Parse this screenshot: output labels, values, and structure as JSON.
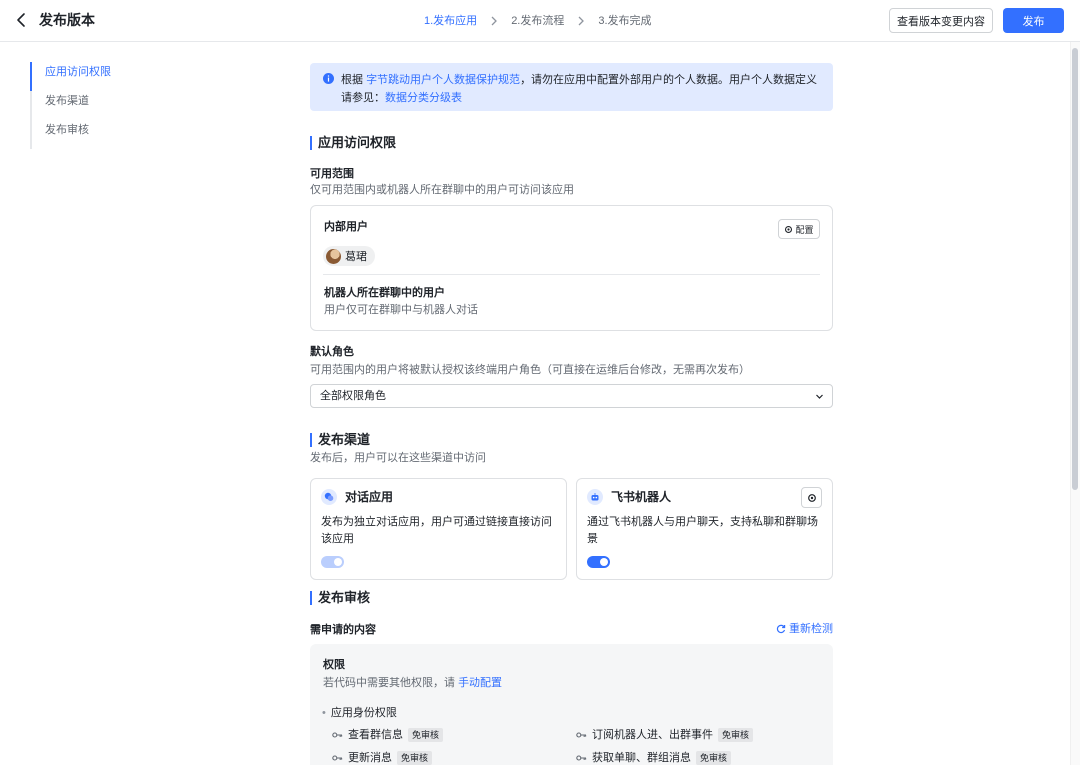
{
  "header": {
    "title": "发布版本",
    "steps": [
      "1.发布应用",
      "2.发布流程",
      "3.发布完成"
    ],
    "view_changes_label": "查看版本变更内容",
    "publish_label": "发布"
  },
  "sidebar": {
    "items": [
      "应用访问权限",
      "发布渠道",
      "发布审核"
    ],
    "active_index": 0
  },
  "notice": {
    "prefix": "根据",
    "link1": "字节跳动用户个人数据保护规范",
    "middle": "，请勿在应用中配置外部用户的个人数据。用户个人数据定义请参见：",
    "link2": "数据分类分级表"
  },
  "access": {
    "section_title": "应用访问权限",
    "scope_label": "可用范围",
    "scope_desc": "仅可用范围内或机器人所在群聊中的用户可访问该应用",
    "internal_users_label": "内部用户",
    "config_label": "配置",
    "user_chip": "葛珺",
    "group_users_label": "机器人所在群聊中的用户",
    "group_users_desc": "用户仅可在群聊中与机器人对话",
    "role_label": "默认角色",
    "role_desc": "可用范围内的用户将被默认授权该终端用户角色（可直接在运维后台修改，无需再次发布）",
    "role_value": "全部权限角色"
  },
  "channels": {
    "section_title": "发布渠道",
    "section_desc": "发布后，用户可以在这些渠道中访问",
    "items": [
      {
        "name": "对话应用",
        "desc": "发布为独立对话应用，用户可通过链接直接访问该应用",
        "enabled": true,
        "disabled_look": true,
        "icon": "chat-bubble-icon"
      },
      {
        "name": "飞书机器人",
        "desc": "通过飞书机器人与用户聊天，支持私聊和群聊场景",
        "enabled": true,
        "disabled_look": false,
        "icon": "robot-icon"
      }
    ]
  },
  "review": {
    "section_title": "发布审核",
    "content_label": "需申请的内容",
    "recheck_label": "重新检测",
    "perm_title": "权限",
    "perm_desc_prefix": "若代码中需要其他权限，请",
    "perm_desc_link": "手动配置",
    "identity_label": "应用身份权限",
    "tag": "免审核",
    "permissions": [
      "查看群信息",
      "订阅机器人进、出群事件",
      "更新消息",
      "获取单聊、群组消息"
    ]
  },
  "colors": {
    "primary": "#3370ff",
    "notice_bg": "#e1eaff",
    "toggle_disabled": "#bacefd"
  }
}
